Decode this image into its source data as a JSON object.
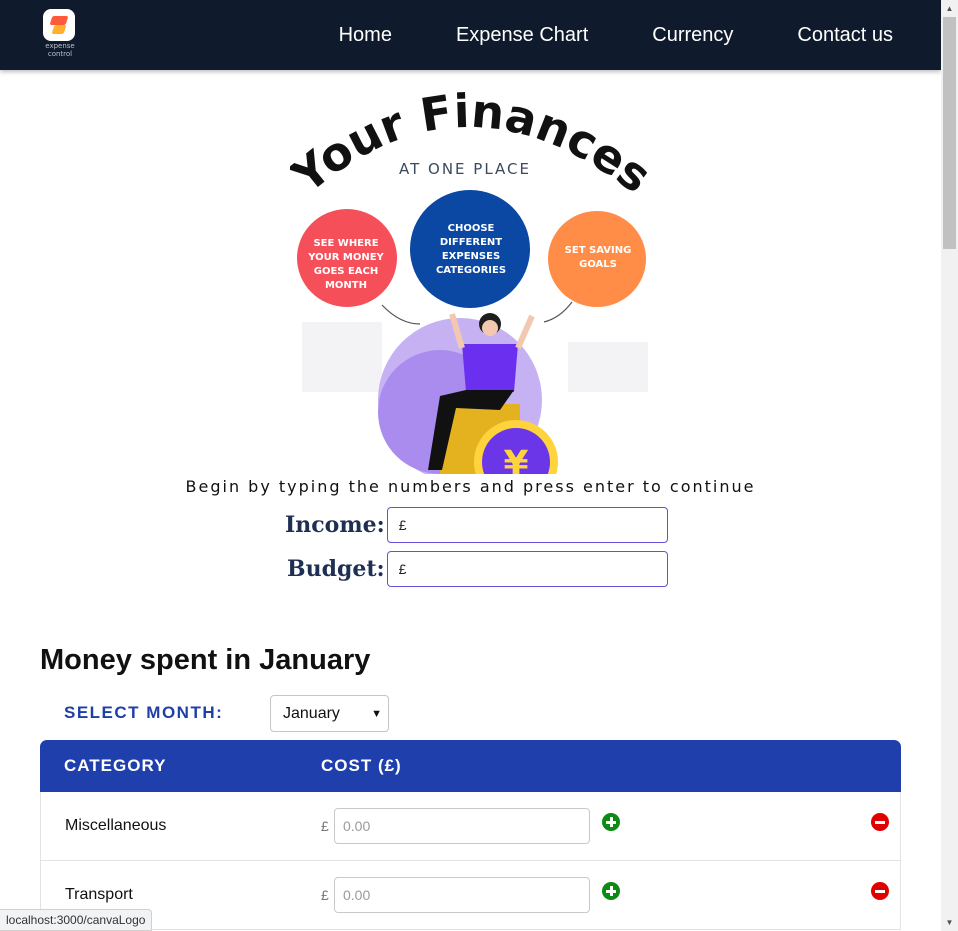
{
  "nav": {
    "logo_text_line1": "expense",
    "logo_text_line2": "control",
    "links": [
      "Home",
      "Expense Chart",
      "Currency",
      "Contact us"
    ]
  },
  "hero": {
    "title": "Your Finances",
    "subtitle": "AT ONE PLACE",
    "bubbles": [
      {
        "lines": [
          "SEE WHERE",
          "YOUR MONEY",
          "GOES EACH",
          "MONTH"
        ],
        "color": "#f5505a"
      },
      {
        "lines": [
          "CHOOSE",
          "DIFFERENT",
          "EXPENSES",
          "CATEGORIES"
        ],
        "color": "#0a48a3"
      },
      {
        "lines": [
          "SET SAVING",
          "GOALS"
        ],
        "color": "#ff8d48"
      }
    ]
  },
  "intro_text": "Begin by typing the numbers and press enter to continue",
  "income": {
    "label": "Income:",
    "currency": "£"
  },
  "budget": {
    "label": "Budget:",
    "currency": "£"
  },
  "section_title": "Money spent in January",
  "month_select": {
    "label": "SELECT MONTH:",
    "selected": "January"
  },
  "table": {
    "headers": [
      "CATEGORY",
      "COST (£)"
    ],
    "rows": [
      {
        "category": "Miscellaneous",
        "currency": "£",
        "placeholder": "0.00"
      },
      {
        "category": "Transport",
        "currency": "£",
        "placeholder": "0.00"
      }
    ]
  },
  "status_bar": "localhost:3000/canvaLogo",
  "colors": {
    "nav_bg": "#0f1b2d",
    "table_header": "#1f3fad",
    "label_blue": "#1f3fa8",
    "input_border": "#6b4fd8",
    "add_green": "#0c8a12",
    "remove_red": "#e00000"
  }
}
